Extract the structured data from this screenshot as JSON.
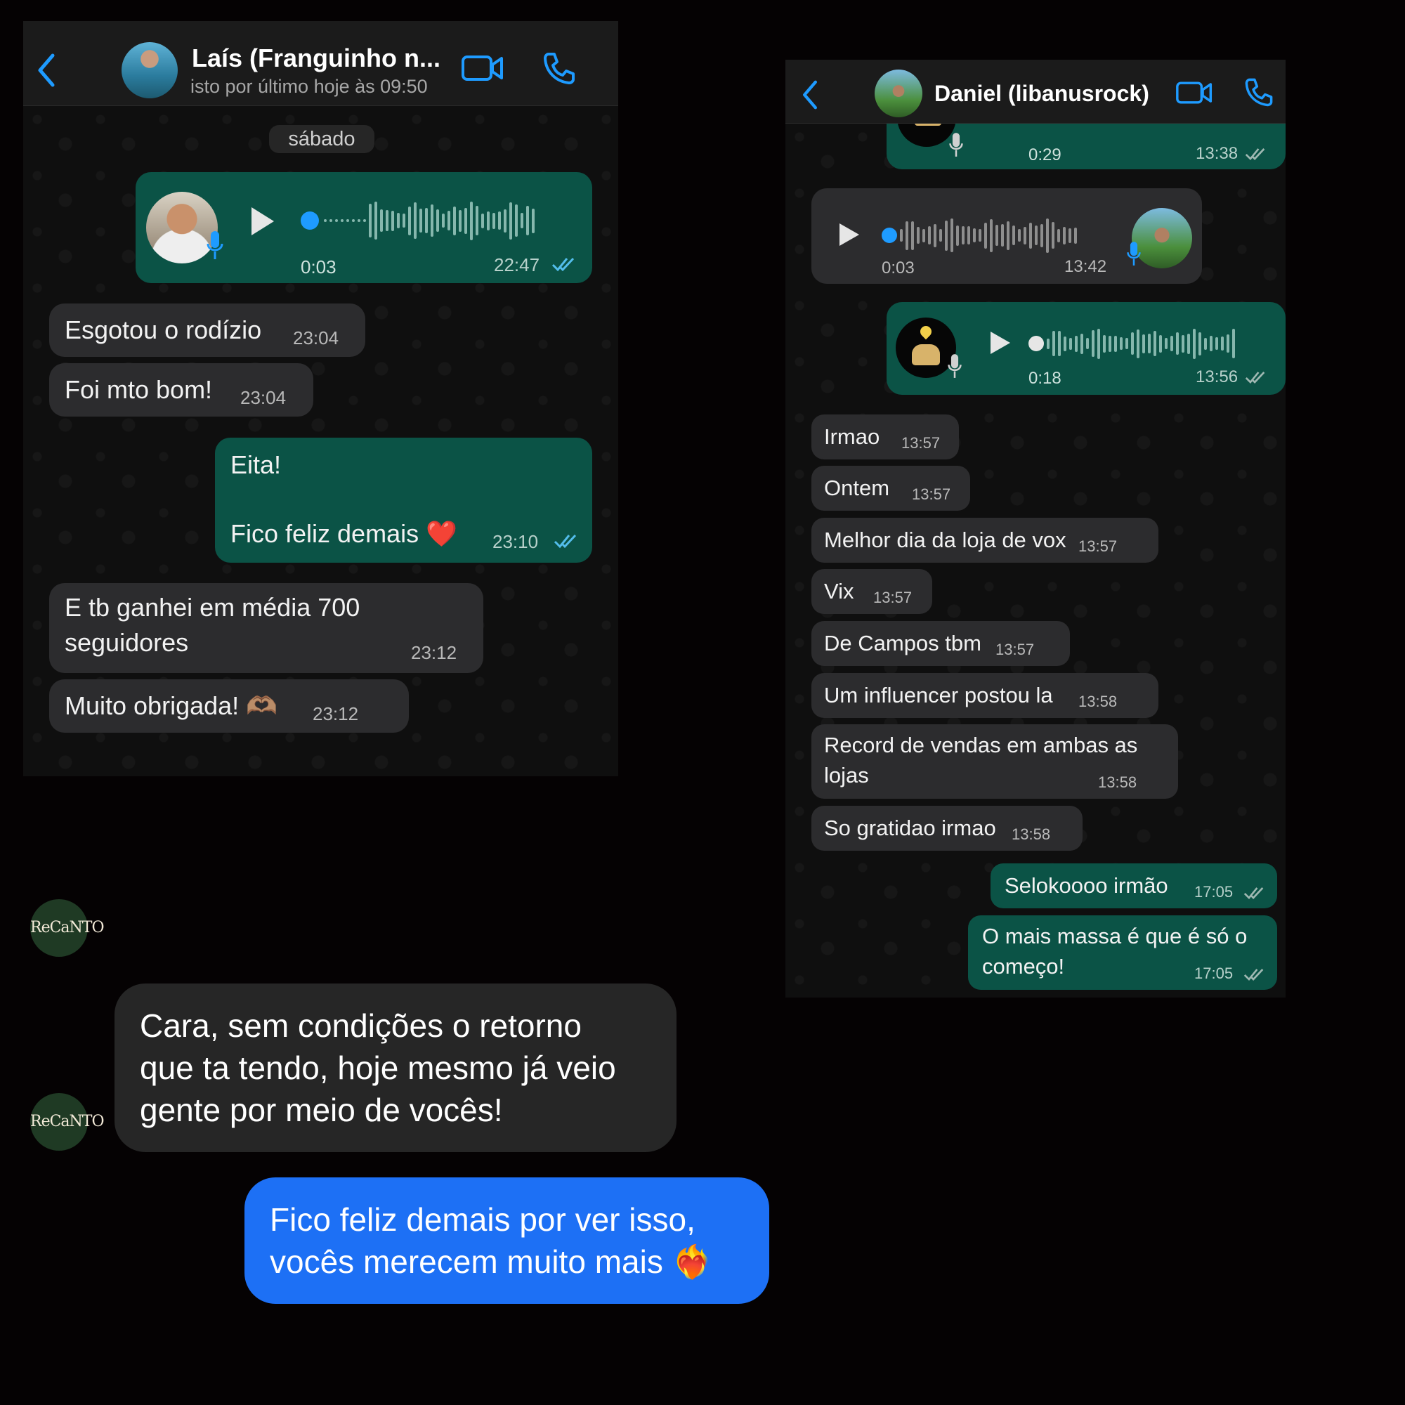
{
  "chat_lais": {
    "contact_name": "Laís (Franguinho n...",
    "status": "isto por último hoje às 09:50",
    "date_separator": "sábado",
    "messages": [
      {
        "type": "voice",
        "direction": "out",
        "duration": "0:03",
        "time": "22:47"
      },
      {
        "type": "text",
        "direction": "in",
        "text": "Esgotou o rodízio",
        "time": "23:04"
      },
      {
        "type": "text",
        "direction": "in",
        "text": "Foi mto bom!",
        "time": "23:04"
      },
      {
        "type": "text",
        "direction": "out",
        "line1": "Eita!",
        "line2": "Fico feliz demais ❤️",
        "time": "23:10"
      },
      {
        "type": "text",
        "direction": "in",
        "line1": "E tb ganhei em média 700",
        "line2": "seguidores",
        "time": "23:12"
      },
      {
        "type": "text",
        "direction": "in",
        "text": "Muito obrigada! 🫶🏽",
        "time": "23:12"
      }
    ]
  },
  "chat_daniel": {
    "contact_name": "Daniel (libanusrock)",
    "messages": [
      {
        "type": "voice",
        "direction": "out",
        "duration": "0:29",
        "time": "13:38"
      },
      {
        "type": "voice",
        "direction": "in",
        "duration": "0:03",
        "time": "13:42"
      },
      {
        "type": "voice",
        "direction": "out",
        "duration": "0:18",
        "time": "13:56"
      },
      {
        "type": "text",
        "direction": "in",
        "text": "Irmao",
        "time": "13:57"
      },
      {
        "type": "text",
        "direction": "in",
        "text": "Ontem",
        "time": "13:57"
      },
      {
        "type": "text",
        "direction": "in",
        "text": "Melhor dia da loja de vox",
        "time": "13:57"
      },
      {
        "type": "text",
        "direction": "in",
        "text": "Vix",
        "time": "13:57"
      },
      {
        "type": "text",
        "direction": "in",
        "text": "De Campos tbm",
        "time": "13:57"
      },
      {
        "type": "text",
        "direction": "in",
        "text": "Um influencer postou la",
        "time": "13:58"
      },
      {
        "type": "text",
        "direction": "in",
        "line1": "Record de vendas em ambas as",
        "line2": "lojas",
        "time": "13:58"
      },
      {
        "type": "text",
        "direction": "in",
        "text": "So gratidao irmao",
        "time": "13:58"
      },
      {
        "type": "text",
        "direction": "out",
        "text": "Selokoooo irmão",
        "time": "17:05"
      },
      {
        "type": "text",
        "direction": "out",
        "line1": "O mais massa é que é só o",
        "line2": "começo!",
        "time": "17:05"
      }
    ]
  },
  "instagram_chat": {
    "logo_text": "ReCaNTO",
    "incoming": {
      "line1": "Cara, sem condições o retorno",
      "line2": "que ta tendo, hoje mesmo já veio",
      "line3": "gente por meio de vocês!"
    },
    "outgoing": {
      "line1": "Fico feliz demais por ver isso,",
      "line2": "vocês merecem muito mais ❤️‍🔥"
    }
  },
  "colors": {
    "whatsapp_accent": "#1e9bff",
    "outgoing_bubble": "#0b5346",
    "incoming_bubble": "#2c2c2e",
    "instagram_out_bubble": "#1d70f5"
  },
  "icons": [
    "back-chevron-icon",
    "video-call-icon",
    "phone-call-icon",
    "play-icon",
    "microphone-icon",
    "double-check-icon"
  ]
}
